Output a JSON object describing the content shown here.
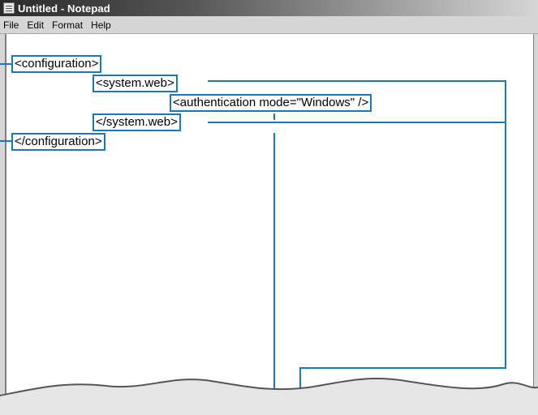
{
  "window": {
    "title": "Untitled - Notepad",
    "title_icon": "notepad-icon"
  },
  "menu": {
    "items": [
      "File",
      "Edit",
      "Format",
      "Help"
    ]
  },
  "editor": {
    "lines": [
      "<configuration>",
      "<system.web>",
      "<authentication mode=\"Windows\" />",
      "</system.web>",
      "</configuration>"
    ]
  },
  "colors": {
    "callout": "#1a79b8",
    "titlebar_dark": "#2a2a2a",
    "menu_bg": "#d6d6d6"
  }
}
